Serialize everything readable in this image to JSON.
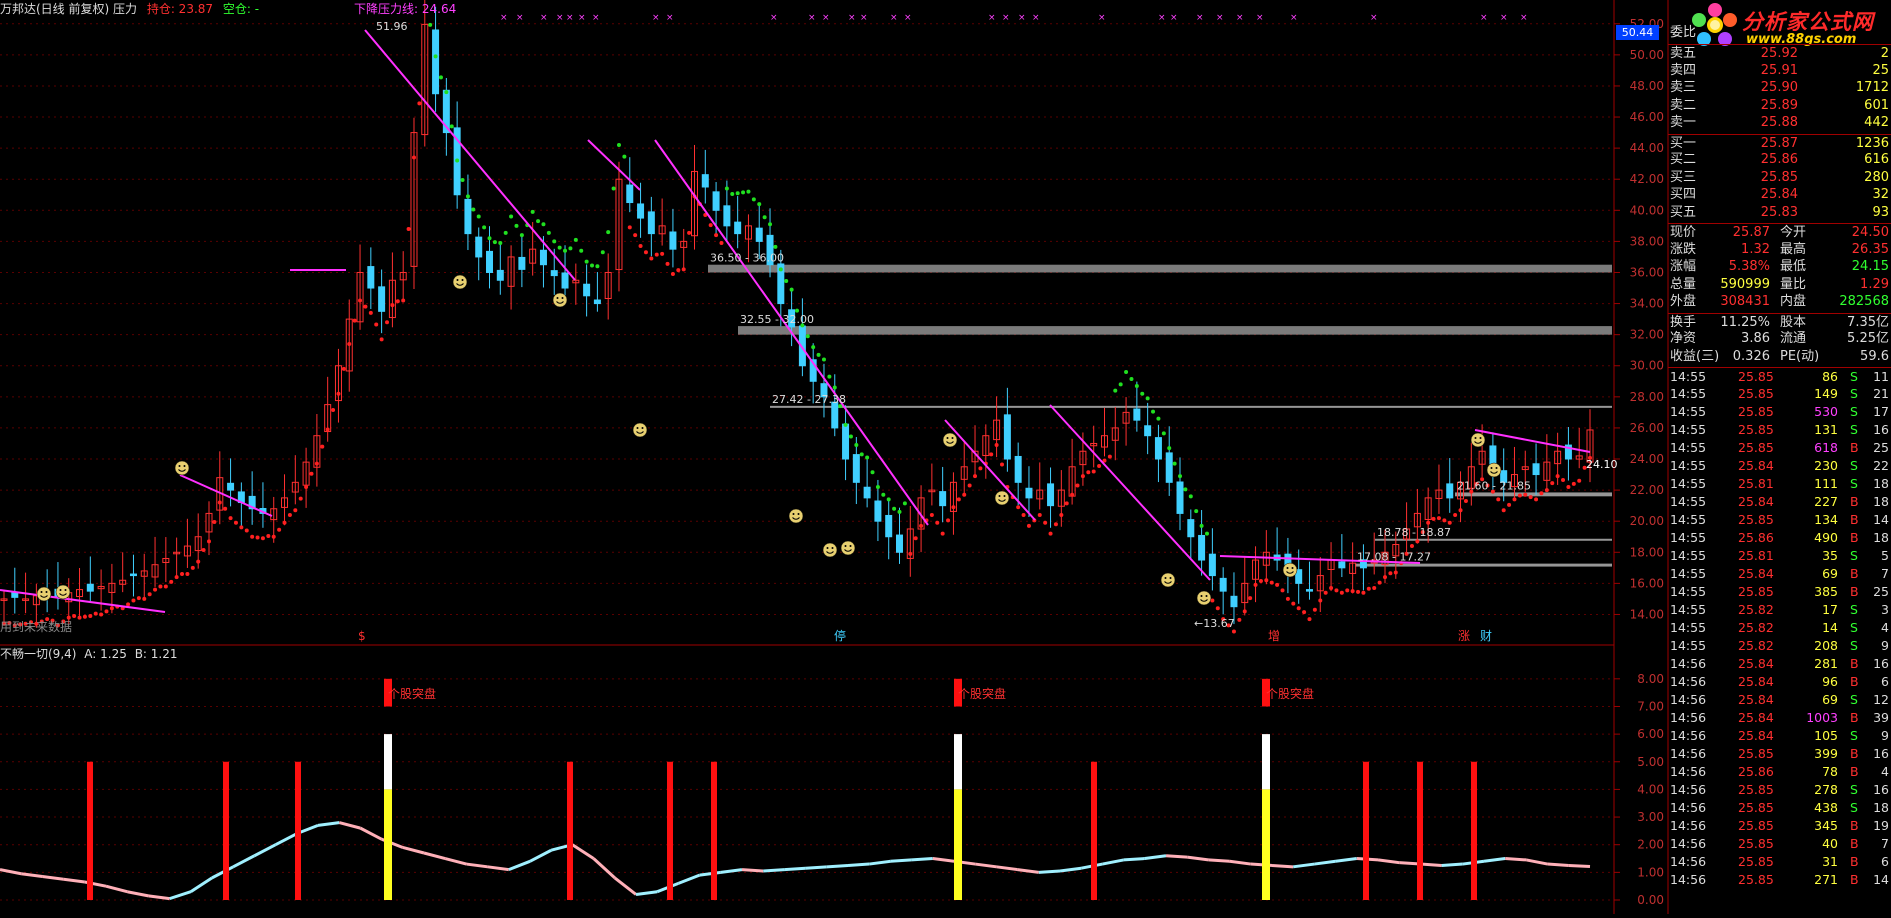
{
  "header": {
    "title": "万邦达(日线 前复权) 压力",
    "hold_label": "持仓: 23.87",
    "short_label": "空仓: -",
    "pressure_label": "下降压力线: 24.64",
    "cur_price_badge": "50.44",
    "future_data_note": "用到未来数据",
    "hold_color": "#ff3030",
    "short_color": "#30ff30",
    "pressure_color": "#ff40ff"
  },
  "indicator": {
    "title": "不畅一切(9,4)",
    "a_label": "A: 1.25",
    "b_label": "B: 1.21",
    "signal_label": "个股突盘"
  },
  "price_axis": [
    "52.00",
    "50.00",
    "48.00",
    "46.00",
    "44.00",
    "42.00",
    "40.00",
    "38.00",
    "36.00",
    "34.00",
    "32.00",
    "30.00",
    "28.00",
    "26.00",
    "24.00",
    "22.00",
    "20.00",
    "18.00",
    "16.00",
    "14.00"
  ],
  "ind_axis": [
    "8.00",
    "7.00",
    "6.00",
    "5.00",
    "4.00",
    "3.00",
    "2.00",
    "1.00",
    "0.00"
  ],
  "zones": [
    {
      "label": "36.50 - 36.00",
      "lo": 36.0,
      "hi": 36.5
    },
    {
      "label": "32.55 - 32.00",
      "lo": 32.0,
      "hi": 32.55
    },
    {
      "label": "27.42 - 27.38",
      "lo": 27.38,
      "hi": 27.42
    },
    {
      "label": "21.60 - 21.85",
      "lo": 21.6,
      "hi": 21.85
    },
    {
      "label": "18.78 - 18.87",
      "lo": 18.78,
      "hi": 18.87
    },
    {
      "label": "17.08 - 17.27",
      "lo": 17.08,
      "hi": 17.27
    }
  ],
  "annotations": {
    "peak": "51.96",
    "low": "13.67",
    "last": "24.10",
    "bottom_marks": [
      "$",
      "停",
      "增",
      "涨",
      "财"
    ]
  },
  "quote": {
    "wei_label": "委比",
    "asks": [
      {
        "label": "卖五",
        "price": "25.92",
        "vol": "2"
      },
      {
        "label": "卖四",
        "price": "25.91",
        "vol": "25"
      },
      {
        "label": "卖三",
        "price": "25.90",
        "vol": "1712"
      },
      {
        "label": "卖二",
        "price": "25.89",
        "vol": "601"
      },
      {
        "label": "卖一",
        "price": "25.88",
        "vol": "442"
      }
    ],
    "bids": [
      {
        "label": "买一",
        "price": "25.87",
        "vol": "1236"
      },
      {
        "label": "买二",
        "price": "25.86",
        "vol": "616"
      },
      {
        "label": "买三",
        "price": "25.85",
        "vol": "280"
      },
      {
        "label": "买四",
        "price": "25.84",
        "vol": "32"
      },
      {
        "label": "买五",
        "price": "25.83",
        "vol": "93"
      }
    ],
    "stats": [
      {
        "l1": "现价",
        "v1": "25.87",
        "c1": "#ff3030",
        "l2": "今开",
        "v2": "24.50",
        "c2": "#ff3030"
      },
      {
        "l1": "涨跌",
        "v1": "1.32",
        "c1": "#ff3030",
        "l2": "最高",
        "v2": "26.35",
        "c2": "#ff3030"
      },
      {
        "l1": "涨幅",
        "v1": "5.38%",
        "c1": "#ff3030",
        "l2": "最低",
        "v2": "24.15",
        "c2": "#30ff30"
      },
      {
        "l1": "总量",
        "v1": "590999",
        "c1": "#ffff40",
        "l2": "量比",
        "v2": "1.29",
        "c2": "#ff3030"
      },
      {
        "l1": "外盘",
        "v1": "308431",
        "c1": "#ff3030",
        "l2": "内盘",
        "v2": "282568",
        "c2": "#30ff30"
      }
    ],
    "stats2": [
      {
        "l1": "换手",
        "v1": "11.25%",
        "l2": "股本",
        "v2": "7.35亿"
      },
      {
        "l1": "净资",
        "v1": "3.86",
        "l2": "流通",
        "v2": "5.25亿"
      },
      {
        "l1": "收益(三)",
        "v1": "0.326",
        "l2": "PE(动)",
        "v2": "59.6"
      }
    ]
  },
  "ticks": [
    {
      "t": "14:55",
      "p": "25.85",
      "v": "86",
      "s": "S",
      "n": "11"
    },
    {
      "t": "14:55",
      "p": "25.85",
      "v": "149",
      "s": "S",
      "n": "21"
    },
    {
      "t": "14:55",
      "p": "25.85",
      "v": "530",
      "s": "S",
      "n": "17"
    },
    {
      "t": "14:55",
      "p": "25.85",
      "v": "131",
      "s": "S",
      "n": "16"
    },
    {
      "t": "14:55",
      "p": "25.85",
      "v": "618",
      "s": "B",
      "n": "25"
    },
    {
      "t": "14:55",
      "p": "25.84",
      "v": "230",
      "s": "S",
      "n": "22"
    },
    {
      "t": "14:55",
      "p": "25.81",
      "v": "111",
      "s": "S",
      "n": "18"
    },
    {
      "t": "14:55",
      "p": "25.84",
      "v": "227",
      "s": "B",
      "n": "18"
    },
    {
      "t": "14:55",
      "p": "25.85",
      "v": "134",
      "s": "B",
      "n": "14"
    },
    {
      "t": "14:55",
      "p": "25.86",
      "v": "490",
      "s": "B",
      "n": "18"
    },
    {
      "t": "14:55",
      "p": "25.81",
      "v": "35",
      "s": "S",
      "n": "5"
    },
    {
      "t": "14:55",
      "p": "25.84",
      "v": "69",
      "s": "B",
      "n": "7"
    },
    {
      "t": "14:55",
      "p": "25.85",
      "v": "385",
      "s": "B",
      "n": "25"
    },
    {
      "t": "14:55",
      "p": "25.82",
      "v": "17",
      "s": "S",
      "n": "3"
    },
    {
      "t": "14:55",
      "p": "25.82",
      "v": "14",
      "s": "S",
      "n": "4"
    },
    {
      "t": "14:55",
      "p": "25.82",
      "v": "208",
      "s": "S",
      "n": "9"
    },
    {
      "t": "14:56",
      "p": "25.84",
      "v": "281",
      "s": "B",
      "n": "16"
    },
    {
      "t": "14:56",
      "p": "25.84",
      "v": "96",
      "s": "B",
      "n": "6"
    },
    {
      "t": "14:56",
      "p": "25.84",
      "v": "69",
      "s": "S",
      "n": "12"
    },
    {
      "t": "14:56",
      "p": "25.84",
      "v": "1003",
      "s": "B",
      "n": "39"
    },
    {
      "t": "14:56",
      "p": "25.84",
      "v": "105",
      "s": "S",
      "n": "9"
    },
    {
      "t": "14:56",
      "p": "25.85",
      "v": "399",
      "s": "B",
      "n": "16"
    },
    {
      "t": "14:56",
      "p": "25.86",
      "v": "78",
      "s": "B",
      "n": "4"
    },
    {
      "t": "14:56",
      "p": "25.85",
      "v": "278",
      "s": "S",
      "n": "16"
    },
    {
      "t": "14:56",
      "p": "25.85",
      "v": "438",
      "s": "S",
      "n": "18"
    },
    {
      "t": "14:56",
      "p": "25.85",
      "v": "345",
      "s": "B",
      "n": "19"
    },
    {
      "t": "14:56",
      "p": "25.85",
      "v": "40",
      "s": "B",
      "n": "7"
    },
    {
      "t": "14:56",
      "p": "25.85",
      "v": "31",
      "s": "B",
      "n": "6"
    },
    {
      "t": "14:56",
      "p": "25.85",
      "v": "271",
      "s": "B",
      "n": "14"
    }
  ],
  "logo": {
    "name": "分析家公式网",
    "url": "www.88gs.com"
  },
  "chart_data": {
    "type": "candlestick",
    "price_closes": [
      15.0,
      15.1,
      15.0,
      15.2,
      15.3,
      15.1,
      15.4,
      15.6,
      15.5,
      15.8,
      16.0,
      16.2,
      16.5,
      16.8,
      17.2,
      17.6,
      18.0,
      18.4,
      19.0,
      20.5,
      22.8,
      22.0,
      21.2,
      20.8,
      20.5,
      20.8,
      21.5,
      22.5,
      23.8,
      25.5,
      27.5,
      30.0,
      33.0,
      36.0,
      35.0,
      33.5,
      35.5,
      36.0,
      45.0,
      51.96,
      47.5,
      45.0,
      41.0,
      38.5,
      37.0,
      36.0,
      35.5,
      37.0,
      36.2,
      37.5,
      36.5,
      35.8,
      35.0,
      35.5,
      34.5,
      34.0,
      36.0,
      42.0,
      40.5,
      39.5,
      38.5,
      39.0,
      37.5,
      38.0,
      42.5,
      41.5,
      40.0,
      39.0,
      38.5,
      39.0,
      38.0,
      36.5,
      34.0,
      32.5,
      30.0,
      29.0,
      28.0,
      26.0,
      24.0,
      22.5,
      21.5,
      20.0,
      19.0,
      18.0,
      19.5,
      21.5,
      22.0,
      21.0,
      22.5,
      23.5,
      24.5,
      25.5,
      26.5,
      24.0,
      22.5,
      21.5,
      22.0,
      21.0,
      22.0,
      23.5,
      24.5,
      25.0,
      25.5,
      26.0,
      27.0,
      26.5,
      25.5,
      24.0,
      22.5,
      20.5,
      19.0,
      17.5,
      16.5,
      15.5,
      14.5,
      16.0,
      17.5,
      18.0,
      17.5,
      16.8,
      16.0,
      15.5,
      16.5,
      17.5,
      17.0,
      17.3,
      17.0,
      17.5,
      18.0,
      18.5,
      19.5,
      20.5,
      21.5,
      22.0,
      21.5,
      22.5,
      23.5,
      24.5,
      23.5,
      22.5,
      23.0,
      23.5,
      23.0,
      23.8,
      24.5,
      24.0,
      24.2,
      25.87
    ],
    "indicator_line": [
      1.1,
      0.95,
      0.85,
      0.75,
      0.65,
      0.5,
      0.3,
      0.15,
      0.05,
      0.3,
      0.8,
      1.2,
      1.6,
      2.0,
      2.4,
      2.7,
      2.8,
      2.6,
      2.2,
      1.9,
      1.7,
      1.5,
      1.3,
      1.2,
      1.1,
      1.4,
      1.8,
      2.0,
      1.5,
      0.8,
      0.2,
      0.3,
      0.6,
      0.9,
      1.0,
      1.1,
      1.05,
      1.1,
      1.15,
      1.2,
      1.25,
      1.3,
      1.4,
      1.45,
      1.5,
      1.4,
      1.3,
      1.2,
      1.1,
      1.0,
      1.05,
      1.15,
      1.3,
      1.45,
      1.5,
      1.6,
      1.55,
      1.45,
      1.4,
      1.3,
      1.25,
      1.2,
      1.3,
      1.4,
      1.5,
      1.45,
      1.35,
      1.3,
      1.25,
      1.3,
      1.4,
      1.5,
      1.45,
      1.3,
      1.25,
      1.21
    ],
    "signal_bars_tall": 3,
    "ylim_price": [
      13,
      52.5
    ],
    "ylim_indicator": [
      0,
      8.5
    ]
  }
}
